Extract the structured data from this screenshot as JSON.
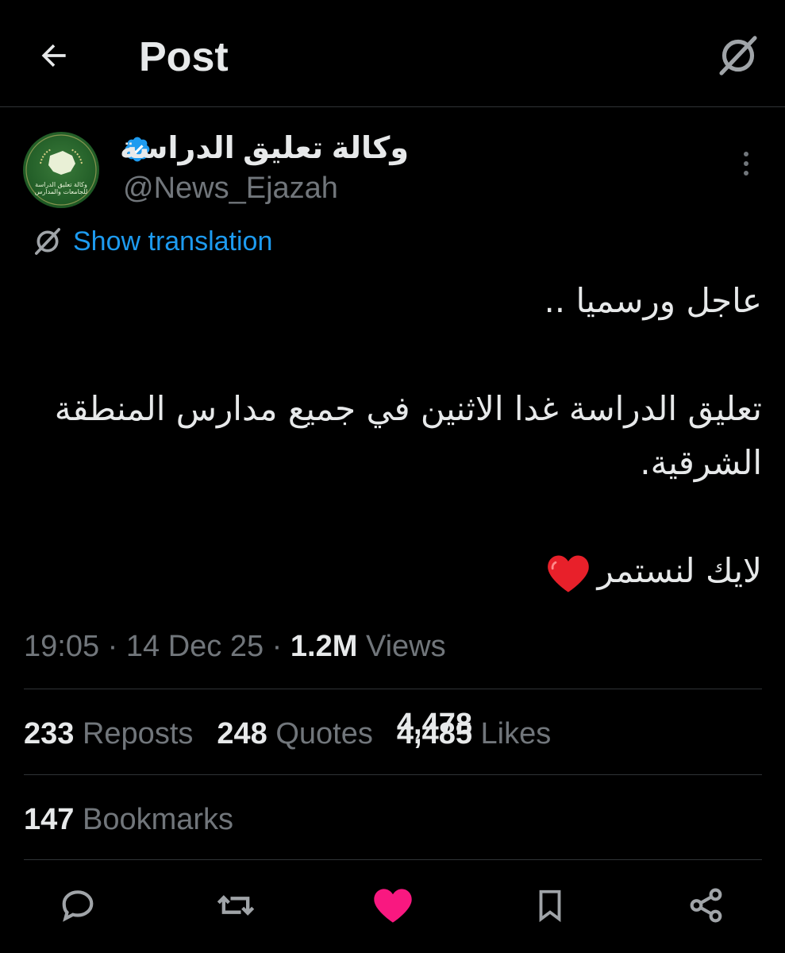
{
  "header": {
    "title": "Post",
    "back_icon": "arrow-left-icon",
    "translate_icon": "translate-icon"
  },
  "author": {
    "display_name": "وكالة تعليق الدراسة",
    "handle": "@News_Ejazah",
    "verified": true,
    "avatar_text": "وكالة تعليق الدراسة للجامعات والمدارس"
  },
  "translation": {
    "label": "Show translation"
  },
  "tweet": {
    "line1": "عاجل ورسميا ..",
    "line2": "تعليق الدراسة غدا الاثنين في جميع مدارس المنطقة الشرقية.",
    "line3": "لايك لنستمر"
  },
  "meta": {
    "time": "19:05",
    "date": "14 Dec 25",
    "views_count": "1.2M",
    "views_label": "Views"
  },
  "stats": {
    "reposts_count": "233",
    "reposts_label": "Reposts",
    "quotes_count": "248",
    "quotes_label": "Quotes",
    "likes_count_old": "4,478",
    "likes_count": "4,485",
    "likes_label": "Likes",
    "bookmarks_count": "147",
    "bookmarks_label": "Bookmarks"
  },
  "colors": {
    "background": "#000000",
    "text": "#e7e9ea",
    "muted": "#71767b",
    "link": "#1d9bf0",
    "like": "#f91880",
    "verified": "#1d9bf0"
  }
}
